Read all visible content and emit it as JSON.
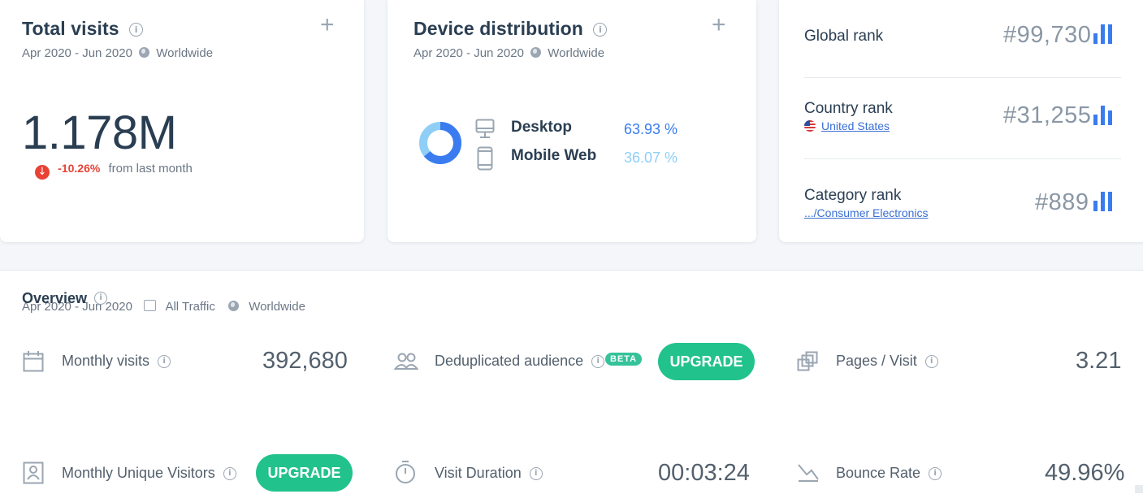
{
  "total_visits": {
    "title": "Total visits",
    "date_range": "Apr 2020 - Jun 2020",
    "region": "Worldwide",
    "value": "1.178M",
    "change": "-10.26%",
    "change_suffix": "from last month"
  },
  "device_distribution": {
    "title": "Device distribution",
    "date_range": "Apr 2020 - Jun 2020",
    "region": "Worldwide",
    "desktop_label": "Desktop",
    "desktop_pct": "63.93 %",
    "desktop_share": 63.93,
    "mobile_label": "Mobile Web",
    "mobile_pct": "36.07 %",
    "mobile_share": 36.07,
    "colors": {
      "desktop": "#3a7cf0",
      "mobile": "#8fcff7"
    }
  },
  "ranks": {
    "global_label": "Global rank",
    "global_value": "#99,730",
    "country_label": "Country rank",
    "country_link": "United States",
    "country_value": "#31,255",
    "category_label": "Category rank",
    "category_link": ".../Consumer Electronics",
    "category_value": "#889"
  },
  "overview": {
    "title": "Overview",
    "date_range": "Apr 2020 - Jun 2020",
    "traffic": "All Traffic",
    "region": "Worldwide",
    "monthly_visits_label": "Monthly visits",
    "monthly_visits_value": "392,680",
    "dedup_label": "Deduplicated audience",
    "beta": "BETA",
    "upgrade_label": "UPGRADE",
    "pages_visit_label": "Pages / Visit",
    "pages_visit_value": "3.21",
    "unique_visitors_label": "Monthly Unique Visitors",
    "visit_duration_label": "Visit Duration",
    "visit_duration_value": "00:03:24",
    "bounce_rate_label": "Bounce Rate",
    "bounce_rate_value": "49.96%"
  },
  "colors": {
    "accent": "#3a7cf0",
    "upgrade": "#22c28d",
    "negative": "#e94235"
  }
}
